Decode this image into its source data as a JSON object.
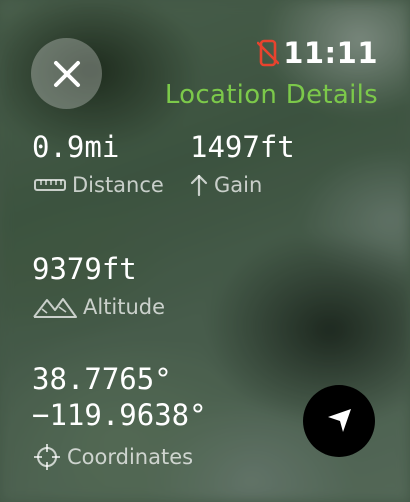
{
  "status": {
    "time": "11:11",
    "indicator_icon": "phone-disconnected-icon",
    "indicator_color": "#e8432e"
  },
  "header": {
    "title": "Location Details",
    "title_color": "#7cc94a",
    "close_icon": "close-icon"
  },
  "details": {
    "distance": {
      "value": "0.9mi",
      "label": "Distance",
      "icon": "ruler-icon"
    },
    "gain": {
      "value": "1497ft",
      "label": "Gain",
      "icon": "arrow-up-icon"
    },
    "altitude": {
      "value": "9379ft",
      "label": "Altitude",
      "icon": "mountains-icon"
    },
    "coordinates": {
      "latitude": "38.7765°",
      "longitude": "−119.9638°",
      "label": "Coordinates",
      "icon": "crosshair-icon"
    }
  },
  "navigation_button": {
    "icon": "location-arrow-icon"
  }
}
